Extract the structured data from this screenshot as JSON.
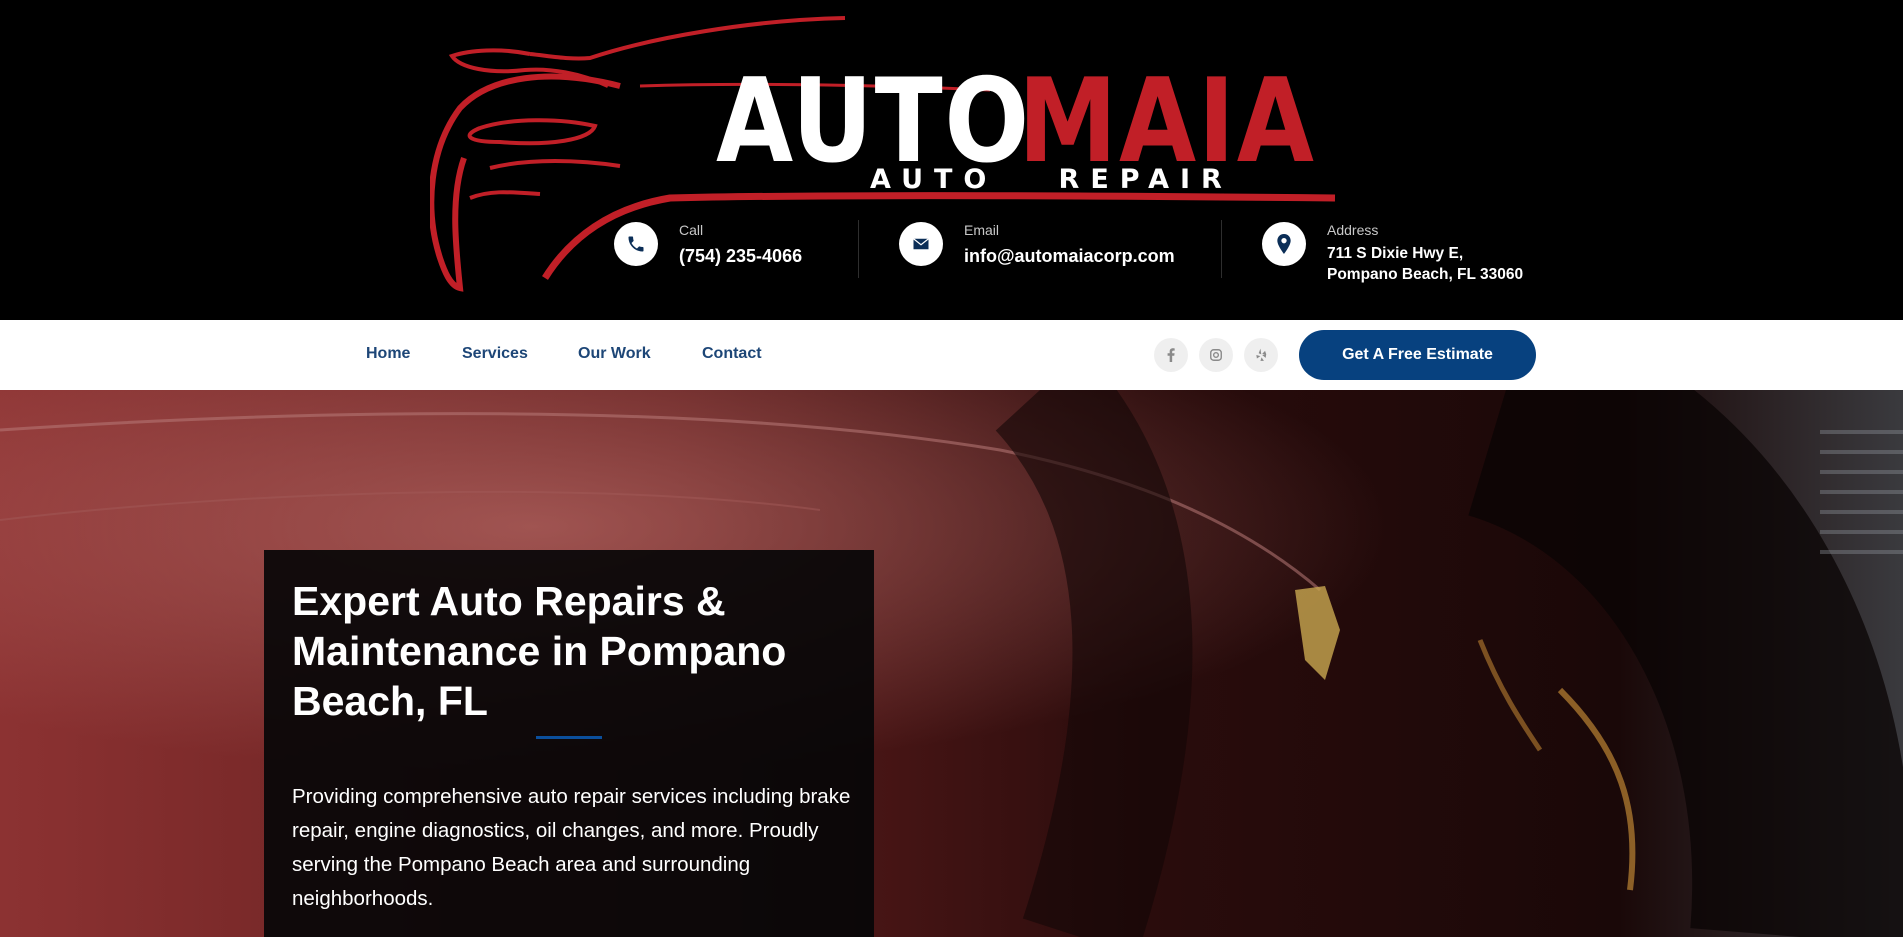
{
  "brand": {
    "logo_word1": "AUTO",
    "logo_word2": "MAIA",
    "logo_sub": "AUTO   REPAIR",
    "accent_red": "#c11f27",
    "primary_blue": "#07417f"
  },
  "contact": {
    "call": {
      "label": "Call",
      "value": "(754) 235-4066",
      "icon": "phone-icon"
    },
    "email": {
      "label": "Email",
      "value": "info@automaiacorp.com",
      "icon": "envelope-icon"
    },
    "address": {
      "label": "Address",
      "line1": "711 S Dixie Hwy E,",
      "line2": "Pompano Beach, FL 33060",
      "icon": "map-pin-icon"
    }
  },
  "nav": {
    "links": [
      "Home",
      "Services",
      "Our Work",
      "Contact"
    ],
    "social": [
      "facebook-icon",
      "instagram-icon",
      "yelp-icon"
    ],
    "cta_label": "Get A Free Estimate"
  },
  "hero": {
    "title": "Expert Auto Repairs & Maintenance in Pompano Beach, FL",
    "text": "Providing comprehensive auto repair services including brake repair, engine diagnostics, oil changes, and more. Proudly serving the Pompano Beach area and surrounding neighborhoods."
  }
}
